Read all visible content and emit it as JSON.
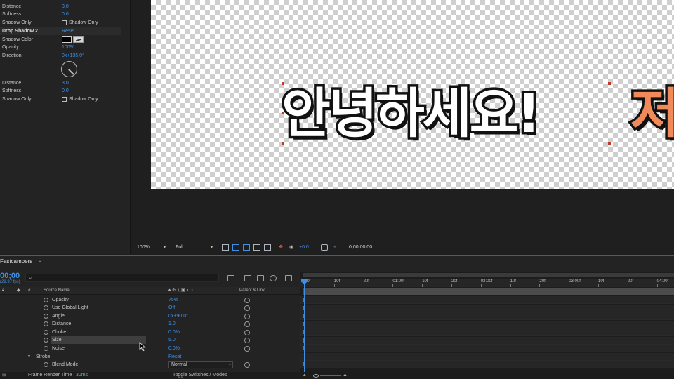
{
  "effect_controls": {
    "top_rows": [
      {
        "label": "Distance",
        "value": "3.0"
      },
      {
        "label": "Softness",
        "value": "0.0"
      }
    ],
    "shadow_only_label": "Shadow Only",
    "shadow_only_checkbox_label": "Shadow Only",
    "drop_shadow_2": {
      "label": "Drop Shadow 2",
      "reset": "Reset"
    },
    "shadow_color_label": "Shadow Color",
    "shadow_color": "#000000",
    "opacity": {
      "label": "Opacity",
      "value": "100%"
    },
    "direction": {
      "label": "Direction",
      "value": "0x+135.0°"
    },
    "distance": {
      "label": "Distance",
      "value": "3.0"
    },
    "softness": {
      "label": "Softness",
      "value": "0.0"
    },
    "shadow_only_2_label": "Shadow Only",
    "shadow_only_2_checkbox_label": "Shadow Only"
  },
  "composition": {
    "title_text": "안녕하세요!",
    "title_text_second": "저",
    "title_fill": "#ffffff",
    "title_second_fill": "#f08a5a",
    "stroke_color": "#111111"
  },
  "viewer_toolbar": {
    "zoom": "100%",
    "resolution": "Full",
    "exposure": "+0.0",
    "timecode": "0;00;00;00"
  },
  "timeline": {
    "tab_name": "Fastcampers",
    "menu_icon": "≡",
    "timecode": "00;00",
    "fps": "(29.97 fps)",
    "search_placeholder": "⌕.",
    "columns": {
      "hash": "#",
      "source_name": "Source Name",
      "parent": "Parent & Link"
    },
    "properties": [
      {
        "name": "Opacity",
        "value": "75%"
      },
      {
        "name": "Use Global Light",
        "value": "Off"
      },
      {
        "name": "Angle",
        "value": "0x+90.0°"
      },
      {
        "name": "Distance",
        "value": "1.0"
      },
      {
        "name": "Choke",
        "value": "0.0%"
      },
      {
        "name": "Size",
        "value": "5.0"
      },
      {
        "name": "Noise",
        "value": "0.0%"
      }
    ],
    "stroke": {
      "name": "Stroke",
      "reset": "Reset"
    },
    "blend_mode": {
      "name": "Blend Mode",
      "value": "Normal"
    },
    "ruler_ticks": [
      "00f",
      "10f",
      "20f",
      "01:00f",
      "10f",
      "20f",
      "02:00f",
      "10f",
      "20f",
      "03:00f",
      "10f",
      "20f",
      "04:00f"
    ],
    "render_time_label": "Frame Render Time",
    "render_time_value": "30ms",
    "toggle_label": "Toggle Switches / Modes"
  },
  "colors": {
    "accent": "#3d8fe8",
    "panel_bg": "#232323"
  }
}
